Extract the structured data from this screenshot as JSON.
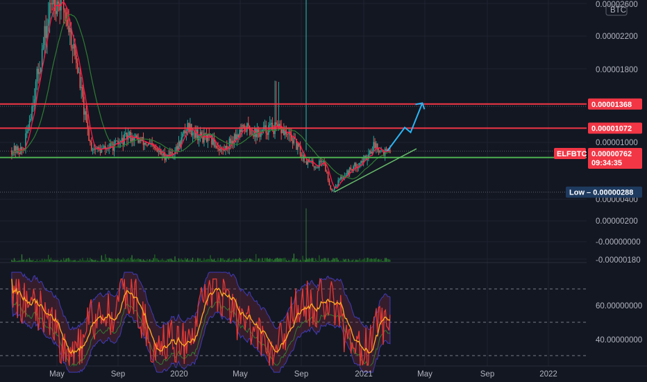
{
  "chart_data": {
    "type": "candlestick",
    "symbol": "ELFBTC",
    "currency": "BTC",
    "x_ticks": [
      "May",
      "Sep",
      "2020",
      "May",
      "Sep",
      "2021",
      "May",
      "Sep",
      "2022"
    ],
    "price_axis_labels": [
      "0.00002600",
      "0.00002200",
      "0.00001800",
      "0.00001000",
      "0.00000400",
      "0.00000200",
      "-0.00000000",
      "-0.00000180"
    ],
    "oscillator_axis_labels": [
      "60.00000000",
      "40.00000000"
    ],
    "oscillator_guides": [
      70,
      50,
      30
    ],
    "horizontal_levels": [
      {
        "price": 1.368e-05,
        "label": "0.00001368",
        "color": "#f23645"
      },
      {
        "price": 1.072e-05,
        "label": "0.00001072",
        "color": "#f23645"
      },
      {
        "price": 7.13e-06,
        "label": "0.00000713",
        "color": "#4caf50"
      }
    ],
    "current_price": {
      "label": "ELFBTC",
      "price": 7.62e-06,
      "value_label": "0.00000762",
      "countdown": "09:34:35",
      "color": "#f23645"
    },
    "low": {
      "label": "Low",
      "price": 2.88e-06,
      "value_label": "0.00000288",
      "color": "#1e3a5f"
    },
    "price_path": [
      [
        0.04,
        8e-06
      ],
      [
        0.09,
        2.7e-05
      ],
      [
        0.11,
        2.55e-05
      ],
      [
        0.13,
        1.9e-05
      ],
      [
        0.145,
        1.2e-05
      ],
      [
        0.155,
        8.5e-06
      ],
      [
        0.17,
        8e-06
      ],
      [
        0.2,
        8.7e-06
      ],
      [
        0.22,
        9.8e-06
      ],
      [
        0.25,
        8.8e-06
      ],
      [
        0.28,
        7.3e-06
      ],
      [
        0.3,
        8e-06
      ],
      [
        0.32,
        1.1e-05
      ],
      [
        0.34,
        9.7e-06
      ],
      [
        0.36,
        9.2e-06
      ],
      [
        0.38,
        7.9e-06
      ],
      [
        0.4,
        9.7e-06
      ],
      [
        0.42,
        1.08e-05
      ],
      [
        0.44,
        1e-05
      ],
      [
        0.46,
        1.08e-05
      ],
      [
        0.48,
        1.05e-05
      ],
      [
        0.5,
        9.2e-06
      ],
      [
        0.52,
        6.8e-06
      ],
      [
        0.54,
        6e-06
      ],
      [
        0.55,
        7e-06
      ],
      [
        0.565,
        3e-06
      ],
      [
        0.58,
        4.5e-06
      ],
      [
        0.6,
        5.8e-06
      ],
      [
        0.62,
        6.8e-06
      ],
      [
        0.64,
        8.8e-06
      ],
      [
        0.65,
        8e-06
      ],
      [
        0.665,
        7.6e-06
      ]
    ],
    "price_spikes": [
      0.47,
      0.475
    ],
    "support_trendline": [
      [
        0.57,
        2.9e-06
      ],
      [
        0.71,
        8.2e-06
      ]
    ],
    "projection": [
      [
        0.66,
        7.9e-06
      ],
      [
        0.69,
        1.08e-05
      ],
      [
        0.7,
        1.02e-05
      ],
      [
        0.72,
        1.38e-05
      ]
    ],
    "projection_color": "#29b6f6"
  }
}
